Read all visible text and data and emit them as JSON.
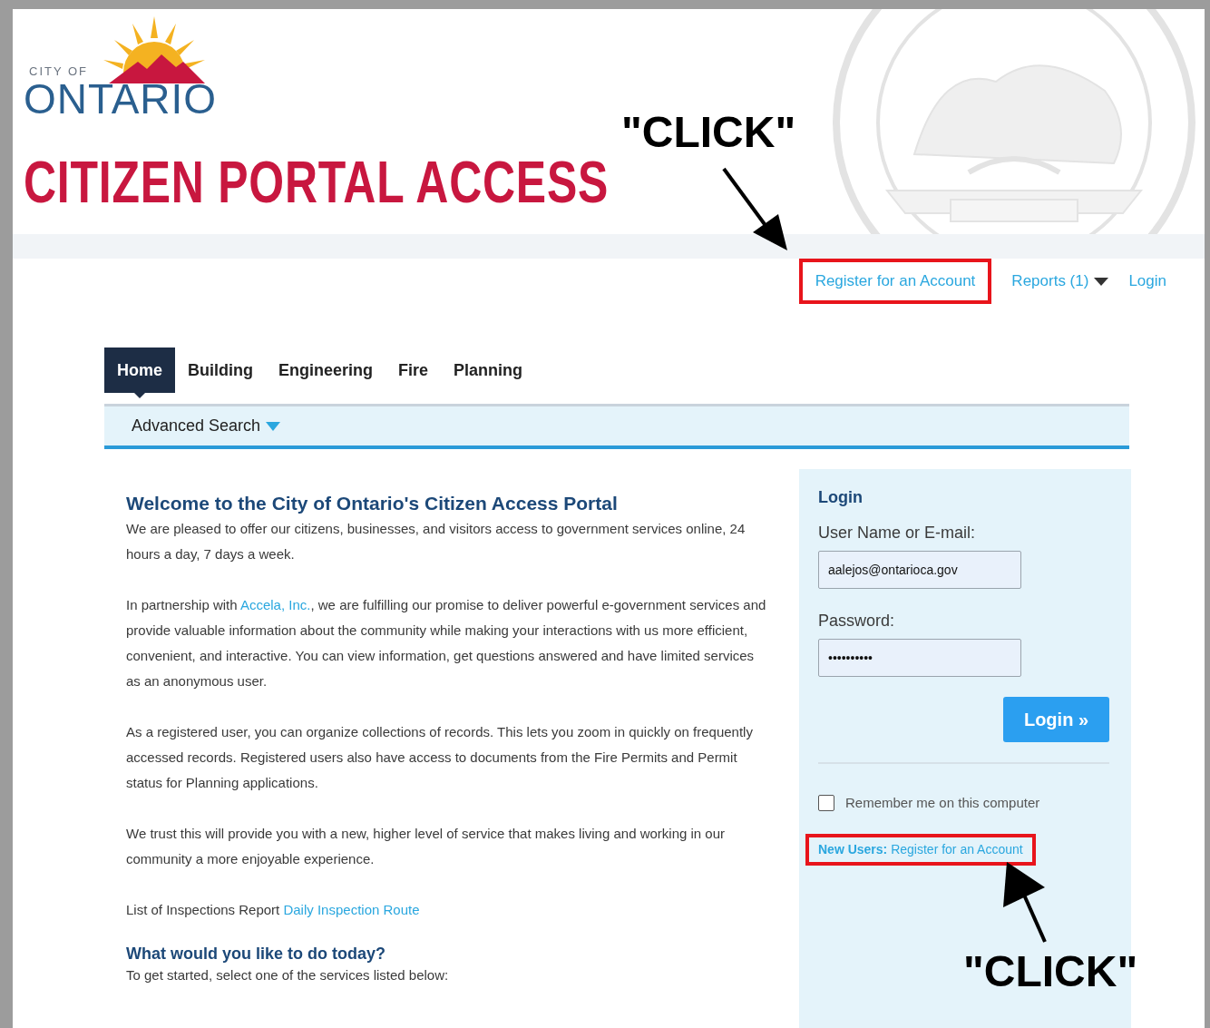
{
  "logo": {
    "small_text": "CITY OF",
    "name": "ONTARIO"
  },
  "banner_title": "CITIZEN PORTAL ACCESS",
  "top_links": [
    {
      "label": "Register for an Account",
      "kind": "link",
      "highlighted": true
    },
    {
      "label": "Reports (1)",
      "kind": "dropdown",
      "highlighted": false
    },
    {
      "label": "Login",
      "kind": "link",
      "highlighted": false
    }
  ],
  "tabs": [
    {
      "label": "Home",
      "selected": true
    },
    {
      "label": "Building",
      "selected": false
    },
    {
      "label": "Engineering",
      "selected": false
    },
    {
      "label": "Fire",
      "selected": false
    },
    {
      "label": "Planning",
      "selected": false
    }
  ],
  "subnav": {
    "label": "Advanced Search"
  },
  "welcome": {
    "title": "Welcome to the City of Ontario's Citizen Access Portal",
    "paragraphs": [
      {
        "before": "We are pleased to offer our citizens, businesses, and visitors access to government services online, 24 hours a day, 7 days a week."
      },
      {
        "before": "In partnership with ",
        "link": "Accela, Inc.",
        "after": ", we are fulfilling our promise to deliver powerful e-government services and provide valuable information about the community while making your interactions with us more efficient, convenient, and interactive. You can view information, get questions answered and have limited services as an anonymous user."
      },
      {
        "before": "As a registered user, you can organize collections of records. This lets you zoom in quickly on frequently accessed records. Registered users also have access to documents from the Fire Permits and Permit status for Planning applications."
      },
      {
        "before": "We trust this will provide you with a new, higher level of service that makes living and working in our community a more enjoyable experience."
      },
      {
        "before": "List of Inspections Report ",
        "link": "Daily Inspection Route"
      }
    ],
    "subtitle": "What would you like to do today?",
    "intro": "To get started, select one of the services listed below:"
  },
  "login": {
    "title": "Login",
    "fields": [
      {
        "label": "User Name or E-mail:",
        "value": "aalejos@ontarioca.gov"
      },
      {
        "label": "Password:",
        "value": "••••••••••"
      }
    ],
    "button": "Login »",
    "remember": {
      "label": "Remember me on this computer",
      "checked": false
    },
    "new_users": {
      "prefix": "New Users:",
      "link": "Register for an Account",
      "highlighted": true
    }
  },
  "annotations": [
    {
      "text": "\"CLICK\""
    },
    {
      "text": "\"CLICK\""
    }
  ]
}
